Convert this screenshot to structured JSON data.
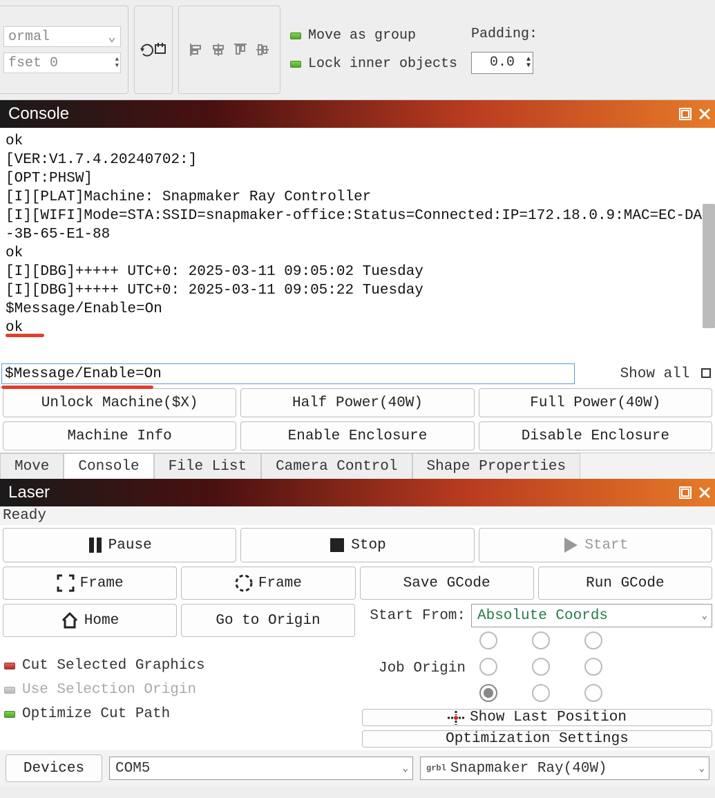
{
  "toolbar": {
    "mode_select": "ormal",
    "offset_label": "fset 0",
    "move_as_group": "Move as group",
    "lock_inner": "Lock inner objects",
    "padding_label": "Padding:",
    "padding_value": "0.0"
  },
  "console_panel": {
    "title": "Console",
    "log_lines": [
      "ok",
      "[VER:V1.7.4.20240702:]",
      "[OPT:PHSW]",
      "[I][PLAT]Machine: Snapmaker Ray Controller",
      "[I][WIFI]Mode=STA:SSID=snapmaker-office:Status=Connected:IP=172.18.0.9:MAC=EC-DA-3B-65-E1-88",
      "ok",
      "[I][DBG]+++++ UTC+0: 2025-03-11 09:05:02 Tuesday",
      "[I][DBG]+++++ UTC+0: 2025-03-11 09:05:22 Tuesday",
      "$Message/Enable=On",
      "ok"
    ],
    "input_value": "$Message/Enable=On",
    "show_all": "Show all",
    "buttons_row1": {
      "unlock": "Unlock Machine($X)",
      "half": "Half Power(40W)",
      "full": "Full Power(40W)"
    },
    "buttons_row2": {
      "info": "Machine Info",
      "enable_enc": "Enable Enclosure",
      "disable_enc": "Disable Enclosure"
    },
    "tabs": {
      "move": "Move",
      "console": "Console",
      "file_list": "File List",
      "camera": "Camera Control",
      "shape": "Shape Properties"
    }
  },
  "laser_panel": {
    "title": "Laser",
    "status": "Ready",
    "pause": "Pause",
    "stop": "Stop",
    "start": "Start",
    "frame1": "Frame",
    "frame2": "Frame",
    "save_gcode": "Save GCode",
    "run_gcode": "Run GCode",
    "home": "Home",
    "go_origin": "Go to Origin",
    "start_from_label": "Start From:",
    "start_from_value": "Absolute Coords",
    "job_origin_label": "Job Origin",
    "cut_selected": "Cut Selected Graphics",
    "use_sel_origin": "Use Selection Origin",
    "optimize_path": "Optimize Cut Path",
    "show_last_pos": "Show Last Position",
    "opt_settings": "Optimization Settings"
  },
  "bottom": {
    "devices": "Devices",
    "port": "COM5",
    "machine": "Snapmaker Ray(40W)"
  }
}
